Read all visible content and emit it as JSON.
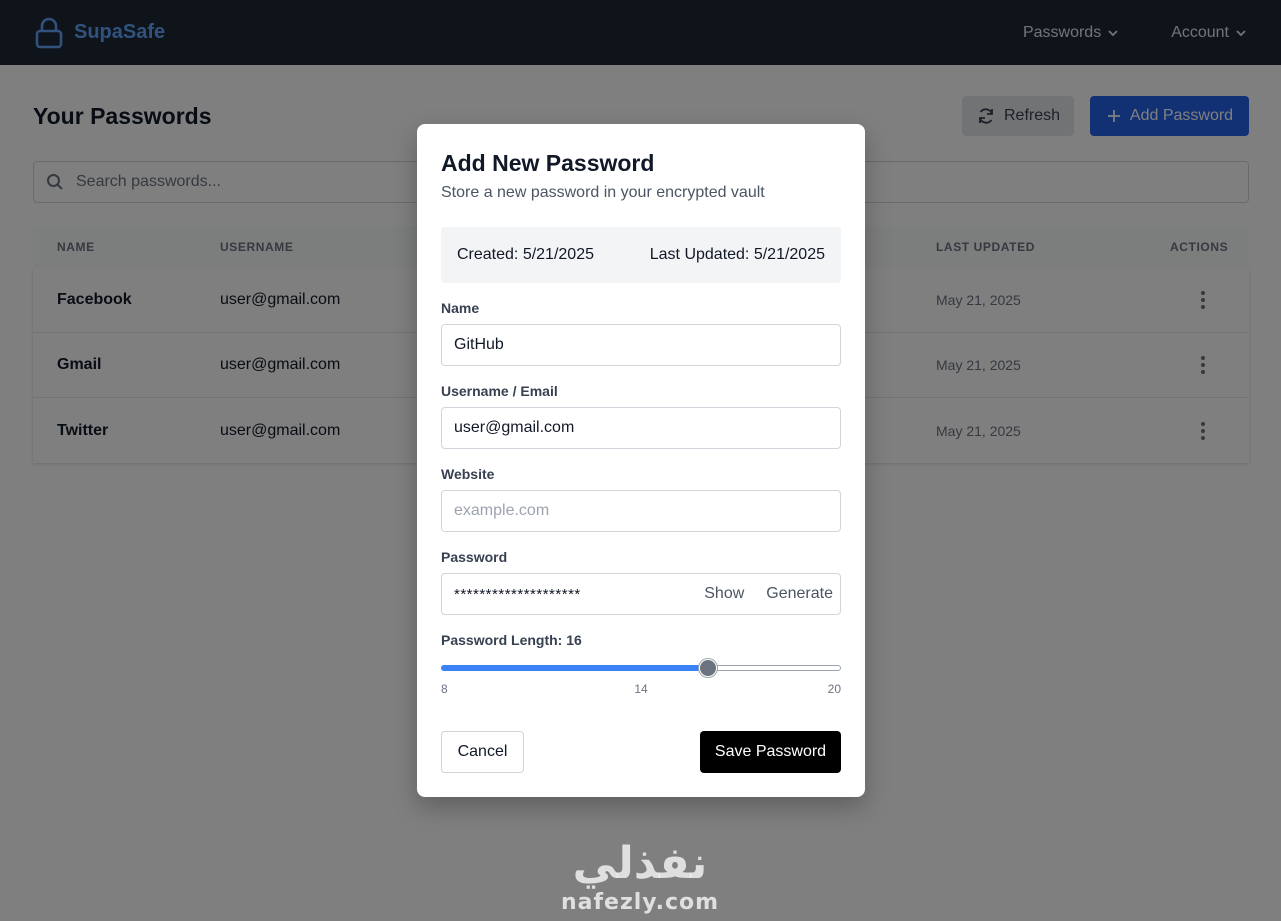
{
  "header": {
    "brand": "SupaSafe",
    "nav": [
      {
        "label": "Passwords"
      },
      {
        "label": "Account"
      }
    ]
  },
  "page": {
    "title": "Your Passwords",
    "refresh_label": "Refresh",
    "add_label": "Add Password",
    "search_placeholder": "Search passwords...",
    "columns": {
      "name": "NAME",
      "username": "USERNAME",
      "last_updated": "LAST UPDATED",
      "actions": "ACTIONS"
    },
    "rows": [
      {
        "name": "Facebook",
        "username": "user@gmail.com",
        "last_updated": "May 21, 2025"
      },
      {
        "name": "Gmail",
        "username": "user@gmail.com",
        "last_updated": "May 21, 2025"
      },
      {
        "name": "Twitter",
        "username": "user@gmail.com",
        "last_updated": "May 21, 2025"
      }
    ]
  },
  "modal": {
    "title": "Add New Password",
    "subtitle": "Store a new password in your encrypted vault",
    "created": "Created: 5/21/2025",
    "updated": "Last Updated: 5/21/2025",
    "name_label": "Name",
    "name_value": "GitHub",
    "username_label": "Username / Email",
    "username_value": "user@gmail.com",
    "website_label": "Website",
    "website_placeholder": "example.com",
    "password_label": "Password",
    "password_value": "********************",
    "show_label": "Show",
    "generate_label": "Generate",
    "length_label": "Password Length: 16",
    "slider": {
      "min": 8,
      "max": 20,
      "value": 16
    },
    "ticks": [
      {
        "label": "8",
        "value": 8
      },
      {
        "label": "14",
        "value": 14
      },
      {
        "label": "20",
        "value": 20
      }
    ],
    "cancel_label": "Cancel",
    "save_label": "Save Password"
  },
  "watermark": {
    "arabic": "نفذلي",
    "latin": "nafezly.com"
  },
  "colors": {
    "brand": "#60a5fa",
    "header_bg": "#1f2937",
    "primary": "#2563eb",
    "slider_fill": "#3b82f6",
    "save_bg": "#000000"
  }
}
